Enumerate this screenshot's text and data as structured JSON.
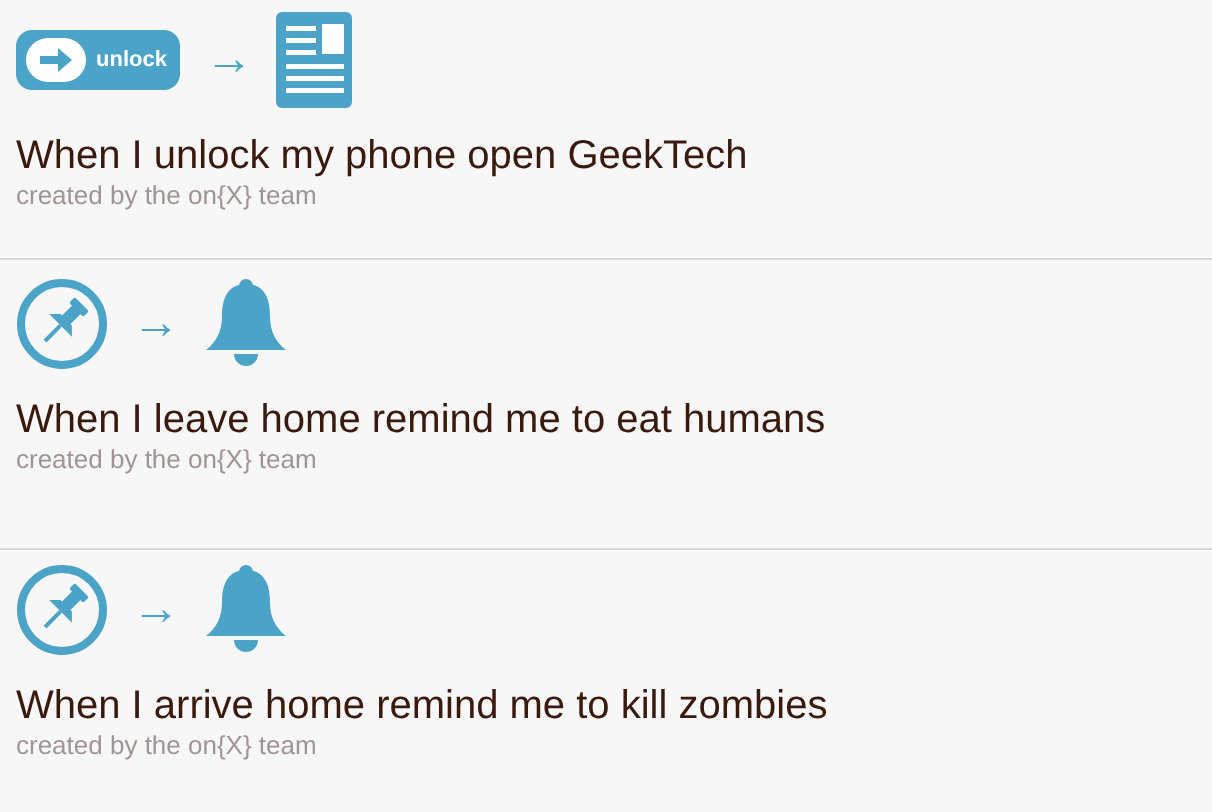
{
  "rules": [
    {
      "trigger": {
        "kind": "unlock",
        "label": "unlock"
      },
      "arrow": "→",
      "action": {
        "kind": "news"
      },
      "title": "When I unlock my phone open GeekTech",
      "credit": "created by the on{X} team"
    },
    {
      "trigger": {
        "kind": "location"
      },
      "arrow": "→",
      "action": {
        "kind": "notification"
      },
      "title": "When I leave home remind me to eat humans",
      "credit": "created by the on{X} team"
    },
    {
      "trigger": {
        "kind": "location"
      },
      "arrow": "→",
      "action": {
        "kind": "notification"
      },
      "title": "When I arrive home remind me to kill zombies",
      "credit": "created by the on{X} team"
    }
  ]
}
